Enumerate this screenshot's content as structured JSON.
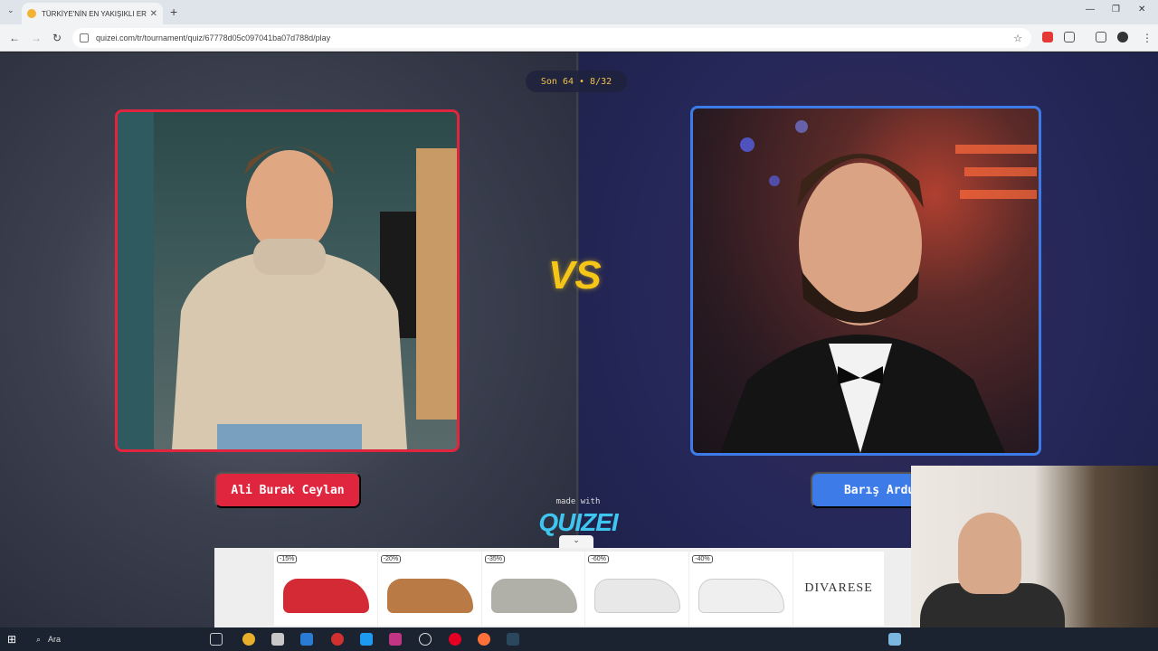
{
  "browser": {
    "tab_title": "TÜRKİYE'NİN EN YAKIŞIKLI ERKE",
    "tab_close": "✕",
    "new_tab": "+",
    "url": "quizei.com/tr/tournament/quiz/67778d05c097041ba07d788d/play"
  },
  "round": {
    "label": "Son 64 • 8/32"
  },
  "left": {
    "name": "Ali Burak Ceylan",
    "border_color": "#e0263e"
  },
  "right": {
    "name": "Barış Arduç",
    "border_color": "#3d7be8"
  },
  "vs_label": "VS",
  "footer": {
    "made_with": "made with",
    "brand": "QUIZEI",
    "toggle_icon": "⌄"
  },
  "ad": {
    "products": [
      {
        "badge": "-15%",
        "color": "#d32a35"
      },
      {
        "badge": "-20%",
        "color": "#b97a45"
      },
      {
        "badge": "-35%",
        "color": "#b0b0a8"
      },
      {
        "badge": "-60%",
        "color": "#f2f2f2"
      },
      {
        "badge": "-40%",
        "color": "#f5f5f5"
      }
    ],
    "brand": "DIVARESE"
  },
  "taskbar": {
    "search_placeholder": "Ara"
  }
}
